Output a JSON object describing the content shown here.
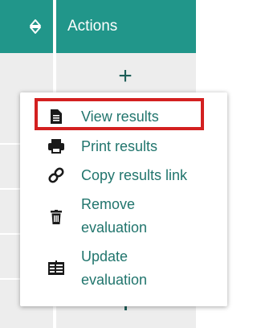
{
  "table": {
    "actions_header": "Actions",
    "add_symbol": "+"
  },
  "menu": {
    "items": [
      {
        "label": "View results",
        "icon": "document-icon"
      },
      {
        "label": "Print results",
        "icon": "printer-icon"
      },
      {
        "label": "Copy results link",
        "icon": "link-icon"
      },
      {
        "label_line1": "Remove",
        "label_line2": "evaluation",
        "icon": "trash-icon"
      },
      {
        "label_line1": "Update",
        "label_line2": "evaluation",
        "icon": "list-edit-icon"
      }
    ]
  },
  "colors": {
    "header_teal": "#21968a",
    "label_teal": "#21756d",
    "highlight_red": "#d32020",
    "grid_gray": "#ededed"
  }
}
